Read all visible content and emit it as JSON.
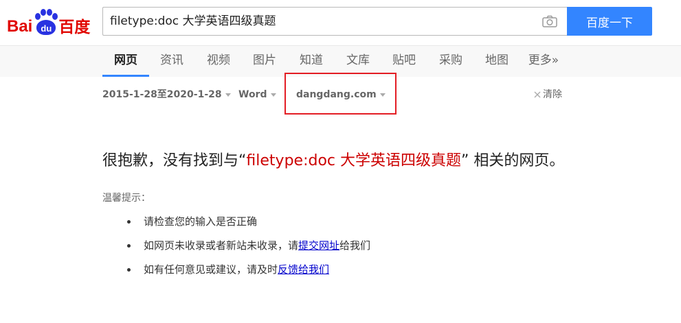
{
  "logo": {
    "bai": "Bai",
    "du": "du",
    "cn": "百度"
  },
  "search": {
    "value": "filetype:doc 大学英语四级真题",
    "button": "百度一下"
  },
  "nav": {
    "tabs": [
      {
        "label": "网页",
        "active": true
      },
      {
        "label": "资讯"
      },
      {
        "label": "视频"
      },
      {
        "label": "图片"
      },
      {
        "label": "知道"
      },
      {
        "label": "文库"
      },
      {
        "label": "贴吧"
      },
      {
        "label": "采购"
      },
      {
        "label": "地图"
      },
      {
        "label": "更多»"
      }
    ]
  },
  "filters": {
    "date": "2015-1-28至2020-1-28",
    "format": "Word",
    "site": "dangdang.com",
    "clear": "清除"
  },
  "result": {
    "prefix": "很抱歉，没有找到与",
    "open_quote": "“",
    "query": "filetype:doc 大学英语四级真题",
    "close_quote": "”",
    "suffix": " 相关的网页。"
  },
  "tips": {
    "title": "温馨提示：",
    "item1": "请检查您的输入是否正确",
    "item2_prefix": "如网页未收录或者新站未收录，请",
    "item2_link": "提交网址",
    "item2_suffix": "给我们",
    "item3_prefix": "如有任何意见或建议，请及时",
    "item3_link": "反馈给我们"
  },
  "colors": {
    "brand_blue": "#3385ff",
    "logo_red": "#e10601",
    "logo_blue": "#2932e1",
    "highlight_red": "#e31c23",
    "query_red": "#cc0000",
    "link_blue": "#0000cc"
  }
}
